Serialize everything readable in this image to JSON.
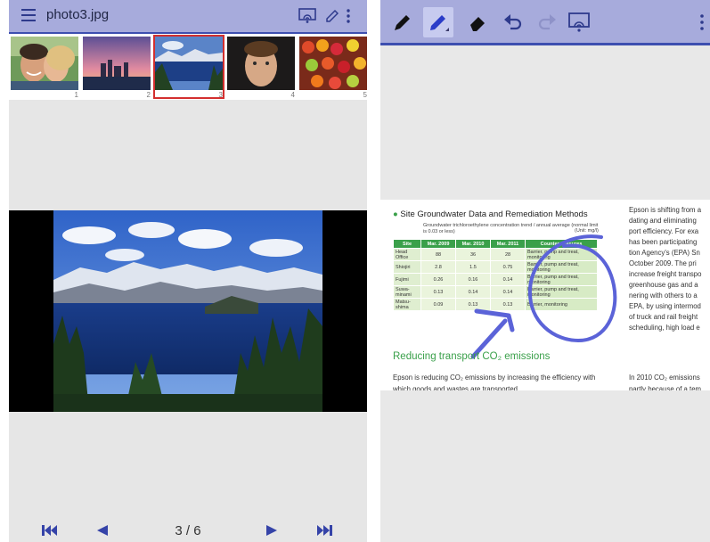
{
  "left_app": {
    "title": "photo3.jpg",
    "thumbnails": [
      {
        "number": "1",
        "subject": "smiling couple"
      },
      {
        "number": "2",
        "subject": "city at dusk"
      },
      {
        "number": "3",
        "subject": "mountain lake",
        "selected": true
      },
      {
        "number": "4",
        "subject": "boy portrait"
      },
      {
        "number": "5",
        "subject": "fruit market"
      }
    ],
    "page_counter": "3 / 6",
    "icons": {
      "menu": "hamburger-menu-icon",
      "cast": "screen-cast-icon",
      "edit": "pen-icon",
      "more": "more-vertical-icon",
      "first": "skip-first-icon",
      "prev": "previous-icon",
      "next": "next-icon",
      "last": "skip-last-icon"
    }
  },
  "right_app": {
    "toolbar_tools": [
      "marker-icon",
      "pen-icon",
      "eraser-icon",
      "undo-icon",
      "redo-icon",
      "screen-cast-icon",
      "more-vertical-icon"
    ],
    "document": {
      "heading": "Site Groundwater Data and Remediation Methods",
      "table_caption": "Groundwater trichloroethylene concentration trend / annual average (normal limit is 0.03 or less)",
      "table_unit": "(Unit: mg/l)",
      "table_headers": [
        "Site",
        "Mar. 2009",
        "Mar. 2010",
        "Mar. 2011",
        "Countermeasures"
      ],
      "table_rows": [
        [
          "Head Office",
          "88",
          "36",
          "28",
          "Barrier, pump and treat, monitoring"
        ],
        [
          "Shiojiri",
          "2.8",
          "1.5",
          "0.75",
          "Barrier, pump and treat, monitoring"
        ],
        [
          "Fujimi",
          "0.26",
          "0.16",
          "0.14",
          "Barrier, pump and treat, monitoring"
        ],
        [
          "Suwa-minami",
          "0.13",
          "0.14",
          "0.14",
          "Barrier, pump and treat, monitoring"
        ],
        [
          "Matsu-shima",
          "0.09",
          "0.13",
          "0.13",
          "Barrier, monitoring"
        ]
      ],
      "subheading": "Reducing transport CO₂ emissions",
      "paragraph": "Epson is reducing CO₂ emissions by increasing the efficiency with which goods and wastes are transported",
      "column2_lines": [
        "Epson is shifting from a",
        "dating and eliminating",
        "port efficiency. For exa",
        "has been participating",
        "tion Agency's (EPA) Sn",
        "October 2009. The pri",
        "increase freight transpo",
        "greenhouse gas and a",
        "nering with others to a",
        "EPA, by using intermod",
        "of truck and rail freight",
        "scheduling, high load e"
      ],
      "column2_footer": "In 2010 CO₂ emissions",
      "column2_footer2": "partly because of a tem"
    },
    "colors": {
      "toolbar": "#a7abdc",
      "accent": "#3d4fb0",
      "ink": "#5b63d8",
      "table_green": "#3aa04a"
    }
  }
}
